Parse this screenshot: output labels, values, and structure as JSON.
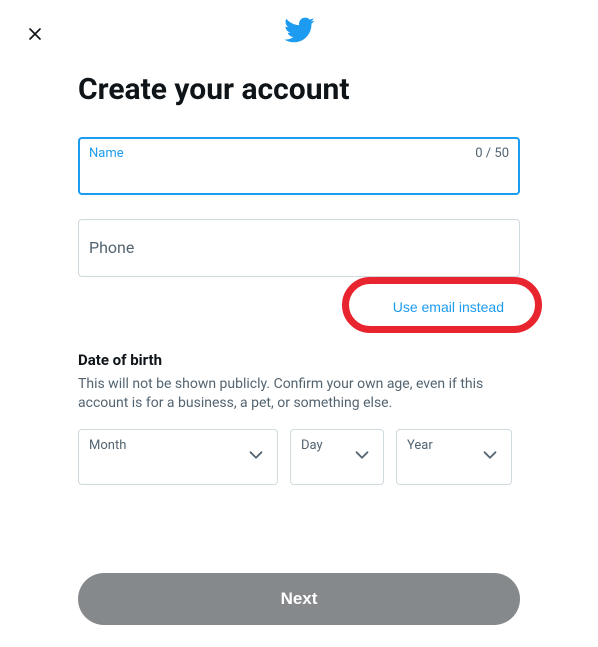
{
  "heading": "Create your account",
  "close_label": "Close",
  "name_field": {
    "label": "Name",
    "value": "",
    "counter": "0 / 50",
    "maxlength": "50"
  },
  "phone_field": {
    "label": "Phone",
    "value": ""
  },
  "use_email_link": "Use email instead",
  "dob": {
    "section_label": "Date of birth",
    "hint": "This will not be shown publicly. Confirm your own age, even if this account is for a business, a pet, or something else.",
    "month_label": "Month",
    "day_label": "Day",
    "year_label": "Year"
  },
  "next_button": "Next",
  "colors": {
    "accent": "#1d9bf0",
    "highlight": "#e8252f"
  }
}
